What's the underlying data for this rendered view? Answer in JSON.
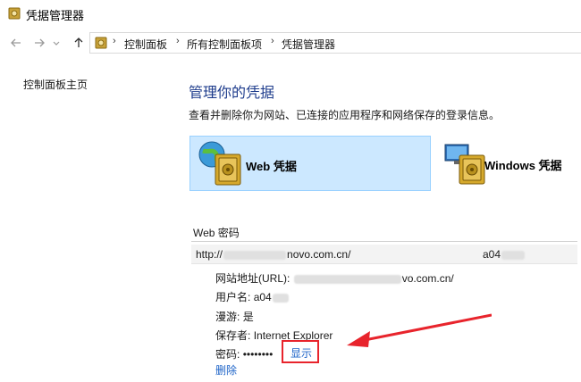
{
  "window": {
    "title": "凭据管理器"
  },
  "nav": {
    "breadcrumbs": [
      "控制面板",
      "所有控制面板项",
      "凭据管理器"
    ]
  },
  "left_pane": {
    "home_link": "控制面板主页"
  },
  "main": {
    "heading": "管理你的凭据",
    "subtitle": "查看并删除你为网站、已连接的应用程序和网络保存的登录信息。",
    "tiles": [
      {
        "label": "Web 凭据",
        "selected": true,
        "icon": "web-credential-vault-icon"
      },
      {
        "label": "Windows 凭据",
        "selected": false,
        "icon": "windows-credential-vault-icon"
      }
    ]
  },
  "web_passwords": {
    "section_title": "Web 密码",
    "entry": {
      "url_prefix": "http://",
      "url_suffix": "novo.com.cn/",
      "user_prefix": "a04"
    },
    "details": {
      "site_label": "网站地址(URL):",
      "site_value": "vo.com.cn/",
      "username_label": "用户名:",
      "username_value": "a04",
      "roaming_label": "漫游:",
      "roaming_value": "是",
      "saved_by_label": "保存者:",
      "saved_by_value": "Internet Explorer",
      "password_label": "密码:",
      "password_mask": "••••••••",
      "show_link": "显示",
      "delete_link": "删除"
    }
  },
  "colors": {
    "heading": "#1e3c8c",
    "link": "#1e64c8",
    "highlight_box": "#e8242c",
    "selected_tile": "#cce8ff"
  }
}
